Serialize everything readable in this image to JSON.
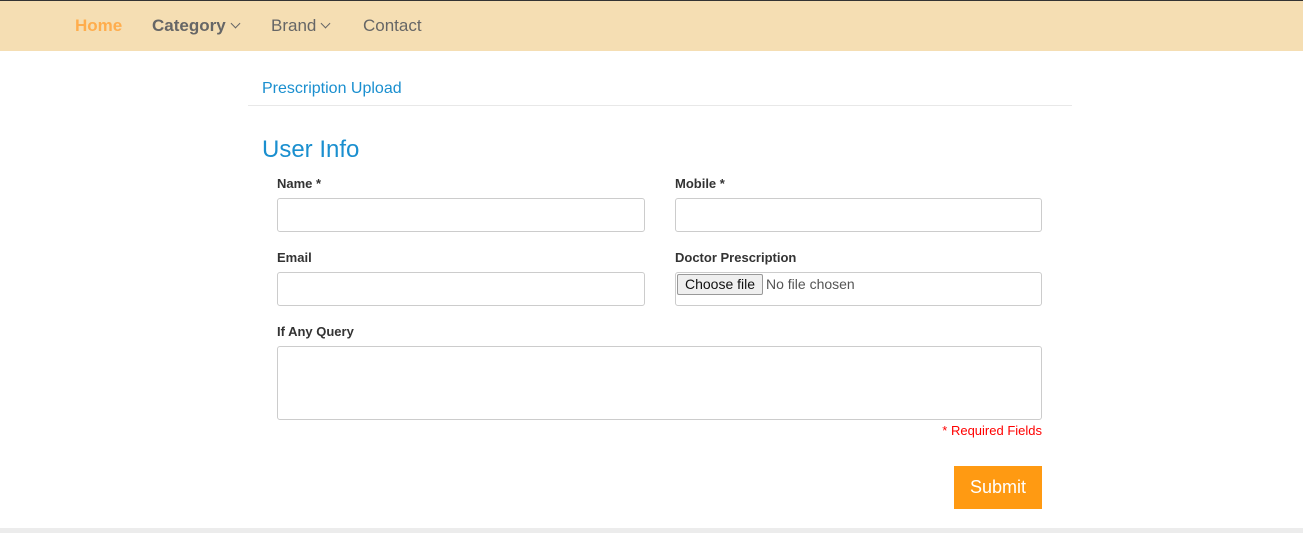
{
  "nav": {
    "items": [
      {
        "label": "Home"
      },
      {
        "label": "Category"
      },
      {
        "label": "Brand"
      },
      {
        "label": "Contact"
      }
    ]
  },
  "breadcrumb": "Prescription Upload",
  "form": {
    "title": "User Info",
    "name_label": "Name *",
    "mobile_label": "Mobile *",
    "email_label": "Email",
    "prescription_label": "Doctor Prescription",
    "file_button": "Choose file",
    "file_status": "No file chosen",
    "query_label": "If Any Query",
    "required_note": "* Required Fields",
    "submit": "Submit"
  },
  "colors": {
    "nav_bg": "#f5deb3",
    "active": "#ffad4d",
    "accent": "#1a8fcf",
    "submit": "#ff9a12",
    "required": "#ff0000"
  }
}
